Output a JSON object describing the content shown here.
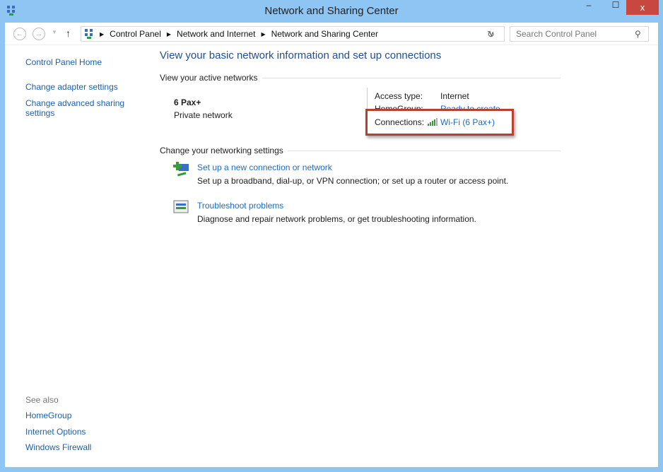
{
  "window": {
    "title": "Network and Sharing Center",
    "close": "x",
    "minimize": "–",
    "maximize": "☐"
  },
  "nav": {
    "breadcrumb": [
      "Control Panel",
      "Network and Internet",
      "Network and Sharing Center"
    ],
    "search_placeholder": "Search Control Panel"
  },
  "sidebar": {
    "items": [
      "Control Panel Home",
      "Change adapter settings",
      "Change advanced sharing settings"
    ],
    "see_also_label": "See also",
    "see_also": [
      "HomeGroup",
      "Internet Options",
      "Windows Firewall"
    ]
  },
  "main": {
    "heading": "View your basic network information and set up connections",
    "active_label": "View your active networks",
    "network": {
      "name": "6 Pax+",
      "type": "Private network"
    },
    "access_type_label": "Access type:",
    "access_type": "Internet",
    "homegroup_label": "HomeGroup:",
    "homegroup": "Ready to create",
    "connections_label": "Connections:",
    "connection": "Wi-Fi (6 Pax+)",
    "change_label": "Change your networking settings",
    "tasks": [
      {
        "title": "Set up a new connection or network",
        "desc": "Set up a broadband, dial-up, or VPN connection; or set up a router or access point.",
        "icon": "new-connection-icon"
      },
      {
        "title": "Troubleshoot problems",
        "desc": "Diagnose and repair network problems, or get troubleshooting information.",
        "icon": "troubleshoot-icon"
      }
    ]
  },
  "colors": {
    "accent": "#1a6cc6",
    "highlight_box": "#b5412f",
    "frame": "#8ec5f2"
  }
}
